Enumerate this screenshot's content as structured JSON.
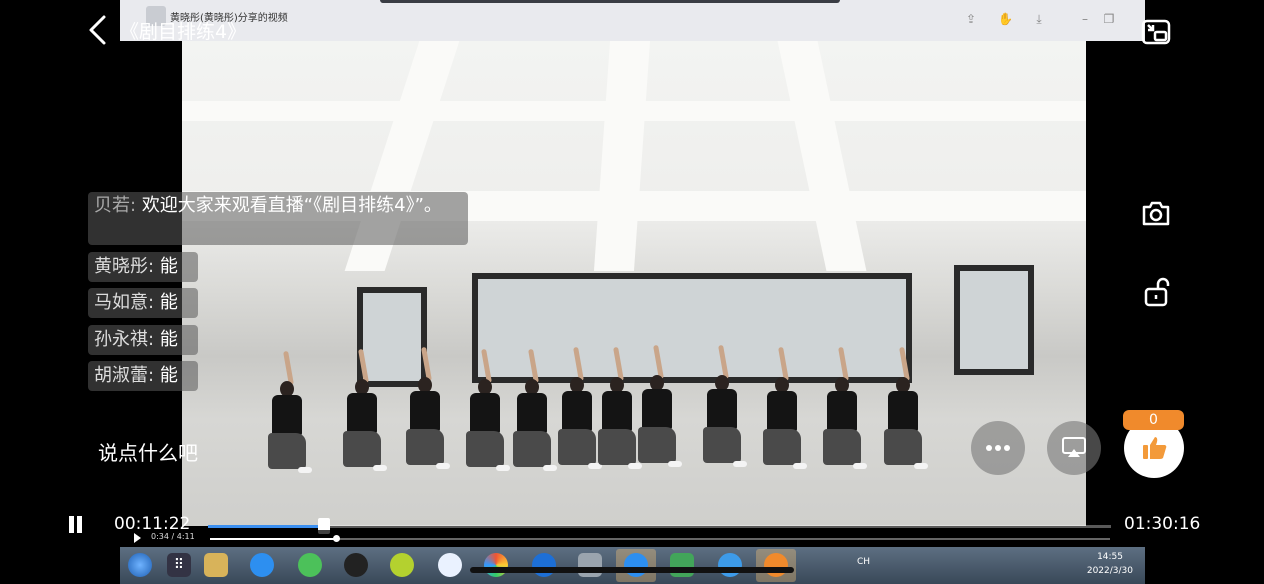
{
  "header": {
    "title": "《剧目排练4》",
    "inner_window_title": "黄晓彤(黄晓彤)分享的视频"
  },
  "chat": {
    "welcome": {
      "who": "贝若:",
      "msg": "欢迎大家来观看直播“《剧目排练4》”。"
    },
    "messages": [
      {
        "who": "黄晓彤:",
        "msg": "能"
      },
      {
        "who": "马如意:",
        "msg": "能"
      },
      {
        "who": "孙永祺:",
        "msg": "能"
      },
      {
        "who": "胡淑蕾:",
        "msg": "能"
      }
    ],
    "input_placeholder": "说点什么吧"
  },
  "like": {
    "count": "0"
  },
  "player": {
    "current_time": "00:11:22",
    "total_time": "01:30:16",
    "progress": 0.128,
    "inner_time": "0:34 / 4:11",
    "inner_progress": 0.14
  },
  "taskbar": {
    "tray_lang": "CH",
    "clock_time": "14:55",
    "clock_date": "2022/3/30"
  },
  "colors": {
    "accent": "#3b8ff0",
    "like_badge": "#f08a2c",
    "like_icon": "#f39a3a"
  },
  "icons": {
    "back": "chevron-left-icon",
    "pip": "picture-in-picture-icon",
    "camera": "camera-icon",
    "lock": "unlock-icon",
    "more": "more-icon",
    "cast": "cast-icon",
    "like": "thumbs-up-icon",
    "pause": "pause-icon"
  }
}
